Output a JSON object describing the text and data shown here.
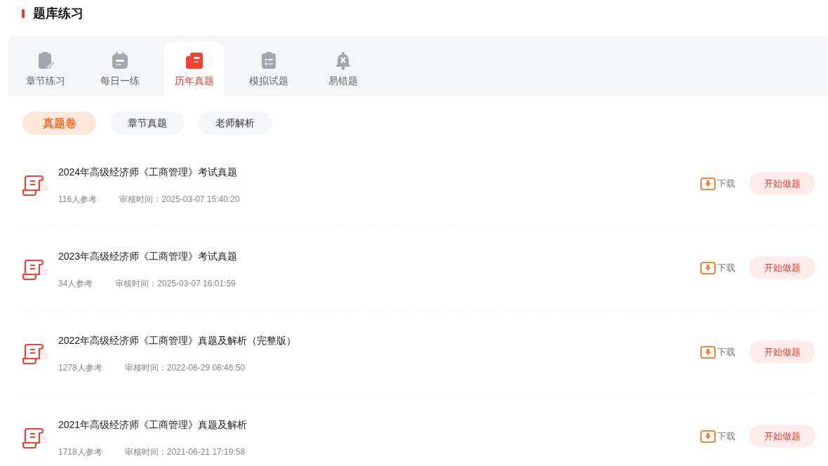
{
  "header": {
    "title": "题库练习"
  },
  "tabs": [
    {
      "label": "章节练习",
      "selected": false
    },
    {
      "label": "每日一练",
      "selected": false
    },
    {
      "label": "历年真题",
      "selected": true
    },
    {
      "label": "模拟试题",
      "selected": false
    },
    {
      "label": "易错题",
      "selected": false
    }
  ],
  "filters": [
    {
      "label": "真题卷",
      "selected": true
    },
    {
      "label": "章节真题",
      "selected": false
    },
    {
      "label": "老师解析",
      "selected": false
    }
  ],
  "papers": [
    {
      "title": "2024年高级经济师《工商管理》考试真题",
      "participants": "116人参考",
      "review_time": "审核时间：2025-03-07 15:40:20",
      "download": "下载",
      "start": "开始做题"
    },
    {
      "title": "2023年高级经济师《工商管理》考试真题",
      "participants": "34人参考",
      "review_time": "审核时间：2025-03-07 16:01:59",
      "download": "下载",
      "start": "开始做题"
    },
    {
      "title": "2022年高级经济师《工商管理》真题及解析（完整版）",
      "participants": "1278人参考",
      "review_time": "审核时间：2022-06-29 08:46:50",
      "download": "下载",
      "start": "开始做题"
    },
    {
      "title": "2021年高级经济师《工商管理》真题及解析",
      "participants": "1718人参考",
      "review_time": "审核时间：2021-06-21 17:19:58",
      "download": "下载",
      "start": "开始做题"
    }
  ]
}
